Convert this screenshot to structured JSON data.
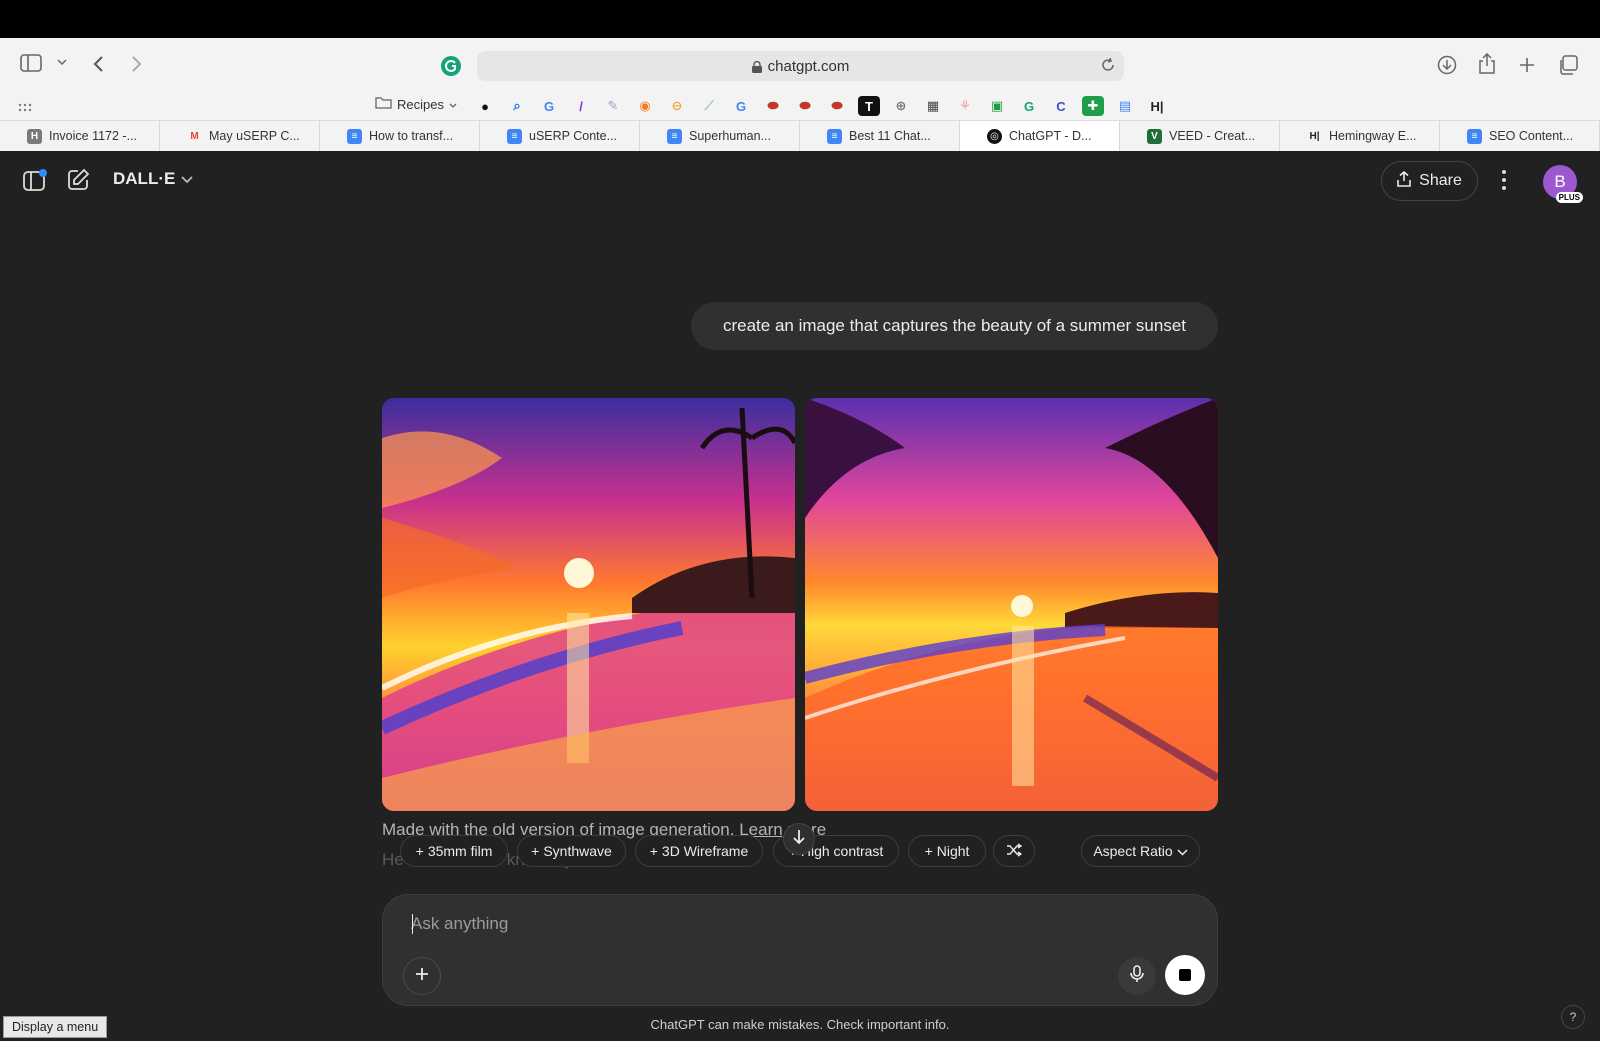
{
  "browser": {
    "url": "chatgpt.com",
    "bookmarks_folder": "Recipes",
    "tabs": [
      {
        "label": "Invoice 1172 -...",
        "icon": "H",
        "color": "#7a7a7a"
      },
      {
        "label": "May uSERP C...",
        "icon": "M",
        "color": "#ea4335"
      },
      {
        "label": "How to transf...",
        "icon": "≡",
        "color": "#4285f4"
      },
      {
        "label": "uSERP Conte...",
        "icon": "≡",
        "color": "#4285f4"
      },
      {
        "label": "Superhuman...",
        "icon": "≡",
        "color": "#4285f4"
      },
      {
        "label": "Best 11 Chat...",
        "icon": "≡",
        "color": "#4285f4"
      },
      {
        "label": "ChatGPT - D...",
        "icon": "◎",
        "color": "#111111"
      },
      {
        "label": "VEED - Creat...",
        "icon": "V",
        "color": "#1f6f3b"
      },
      {
        "label": "Hemingway E...",
        "icon": "H|",
        "color": "#ffffff"
      },
      {
        "label": "SEO Content...",
        "icon": "≡",
        "color": "#4285f4"
      }
    ]
  },
  "header": {
    "model": "DALL·E",
    "share_label": "Share",
    "avatar_initial": "B",
    "avatar_badge": "PLUS"
  },
  "conversation": {
    "user_message": "create an image that captures the beauty of a summer sunset",
    "caption_text": "Made with the old version of image generation.",
    "caption_link": "Learn more",
    "ghost_text": "He                                        a                           s         !!  Let me know if you'd"
  },
  "chips": [
    {
      "label": "35mm film"
    },
    {
      "label": "Synthwave"
    },
    {
      "label": "3D Wireframe"
    },
    {
      "label": "High contrast"
    },
    {
      "label": "Night"
    }
  ],
  "aspect_ratio_label": "Aspect Ratio",
  "composer": {
    "placeholder": "Ask anything"
  },
  "disclaimer": "ChatGPT can make mistakes. Check important info.",
  "help_label": "?",
  "tooltip": "Display a menu"
}
